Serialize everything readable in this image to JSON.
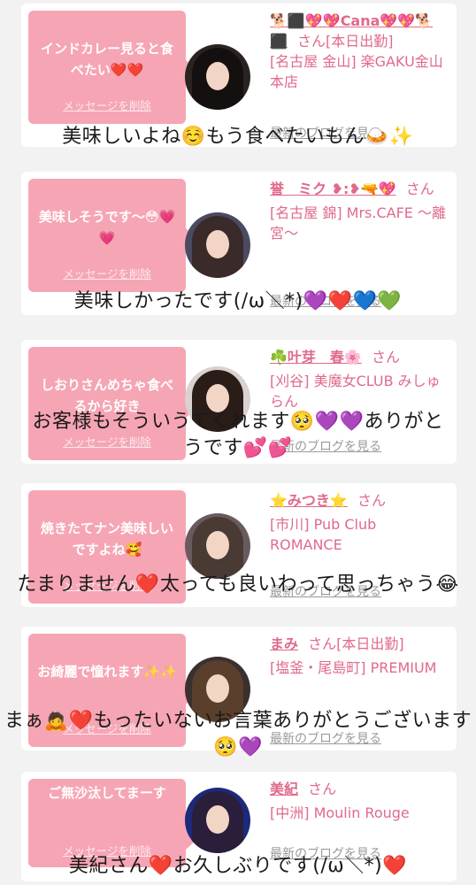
{
  "cards": [
    {
      "message": "インドカレー見ると食べたい❤️❤️",
      "delete_label": "メッセージを削除",
      "name": "🐕⬛💖💖Cana💖💖🐕⬛",
      "honorific": "さん",
      "status": "[本日出勤]",
      "shop": "[名古屋 金山] 楽GAKU金山本店",
      "blog_label": "最新のブログを見る",
      "reply": "美味しいよね☺️もう食べたいもん🍛✨"
    },
    {
      "message": "美味しそうです〜😳💗💗",
      "delete_label": "メッセージを削除",
      "name": "誉　ミク ❥:❥🔫💖",
      "honorific": "さん",
      "status": "",
      "shop": "[名古屋 錦] Mrs.CAFE 〜離宮〜",
      "blog_label": "最新のブログを見る",
      "reply": "美味しかったです(/ω＼*)💜❤️💙💚"
    },
    {
      "message": "しおりさんめちゃ食べるから好き",
      "delete_label": "メッセージを削除",
      "name": "☘️叶芽　春🌸",
      "honorific": "さん",
      "status": "",
      "shop": "[刈谷] 美魔女CLUB みしゅらん",
      "blog_label": "最新のブログを見る",
      "reply": "お客様もそういうてくれます🥺💜💜ありがとうです💕💕"
    },
    {
      "message": "焼きたてナン美味しいですよね🥰",
      "delete_label": "メッセージを削除",
      "name": "⭐みつき⭐",
      "honorific": "さん",
      "status": "",
      "shop": "[市川] Pub Club ROMANCE",
      "blog_label": "最新のブログを見る",
      "reply": "たまりません❤️太っても良いわって思っちゃう😂"
    },
    {
      "message": "お綺麗で憧れます✨✨",
      "delete_label": "メッセージを削除",
      "name": "まみ",
      "honorific": "さん",
      "status": "[本日出勤]",
      "shop": "[塩釜・尾島町] PREMIUM",
      "blog_label": "最新のブログを見る",
      "reply": "まぁ🙇❤️もったいないお言葉ありがとうございます🥺💜"
    },
    {
      "message": "ご無沙汰してまーす",
      "delete_label": "メッセージを削除",
      "name": "美紀",
      "honorific": "さん",
      "status": "",
      "shop": "[中洲] Moulin Rouge",
      "blog_label": "最新のブログを見る",
      "reply": "美紀さん❤️お久しぶりです(/ω＼*)❤️"
    }
  ],
  "colors": {
    "bubble": "#f6a5b4",
    "name_text": "#e06a8a",
    "blog_link": "#9a9a9a",
    "page_bg": "#f2f2f2"
  }
}
